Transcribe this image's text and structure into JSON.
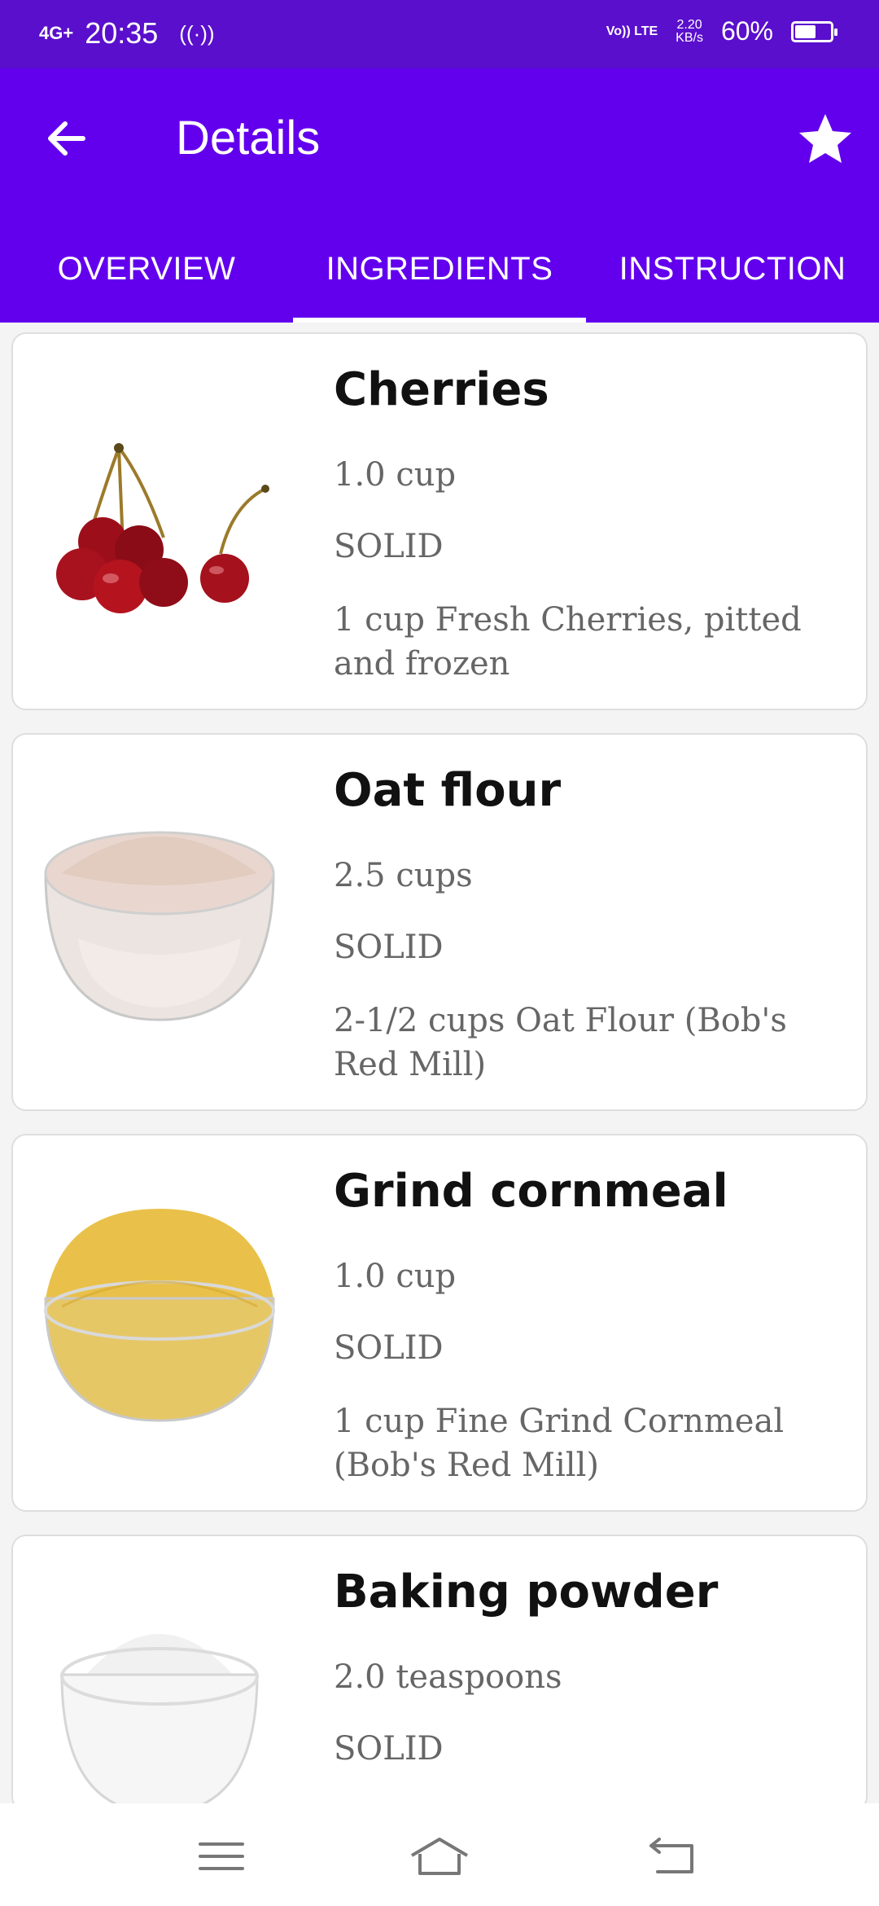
{
  "status_bar": {
    "network": "4G+",
    "time": "20:35",
    "volte": "Vo)) LTE",
    "speed_value": "2.20",
    "speed_unit": "KB/s",
    "battery_percent": "60%",
    "battery_level": 0.6
  },
  "app_bar": {
    "title": "Details",
    "back_icon": "arrow-back-icon",
    "favorite_icon": "star-icon"
  },
  "tabs": [
    {
      "label": "OVERVIEW",
      "active": false
    },
    {
      "label": "INGREDIENTS",
      "active": true
    },
    {
      "label": "INSTRUCTION",
      "active": false
    }
  ],
  "ingredients": [
    {
      "name": "Cherries",
      "quantity": "1.0  cup",
      "state": "SOLID",
      "description": "1 cup Fresh Cherries, pitted and frozen",
      "image": "cherries-image"
    },
    {
      "name": "Oat flour",
      "quantity": "2.5  cups",
      "state": "SOLID",
      "description": "2-1/2 cups Oat Flour (Bob's Red Mill)",
      "image": "oat-flour-bowl-image"
    },
    {
      "name": "Grind cornmeal",
      "quantity": "1.0  cup",
      "state": "SOLID",
      "description": "1 cup Fine Grind Cornmeal (Bob's Red Mill)",
      "image": "cornmeal-bowl-image"
    },
    {
      "name": "Baking powder",
      "quantity": "2.0  teaspoons",
      "state": "SOLID",
      "description": "",
      "image": "baking-powder-bowl-image"
    }
  ],
  "nav_bar": {
    "menu_icon": "menu-icon",
    "home_icon": "home-icon",
    "back_icon": "back-icon"
  },
  "colors": {
    "status_bar": "#5a0fcc",
    "app_bar": "#6200ee",
    "text_primary": "#111111",
    "text_secondary": "#666666"
  }
}
